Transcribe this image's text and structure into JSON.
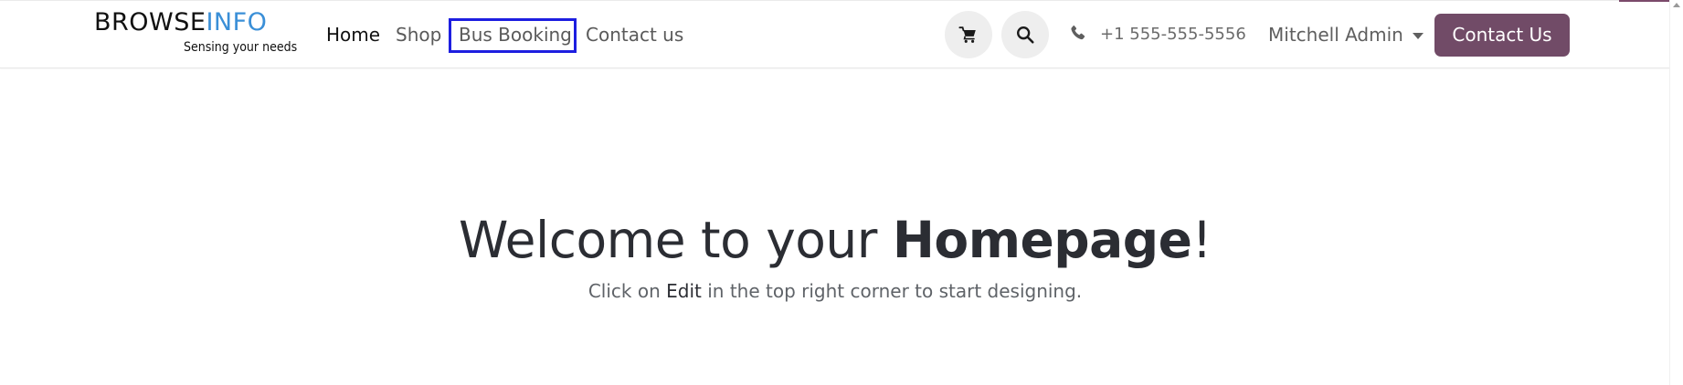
{
  "header": {
    "logo": {
      "part1": "BROWSE",
      "part2": "INFO",
      "tagline": "Sensing your needs"
    },
    "nav": {
      "home": "Home",
      "shop": "Shop",
      "bus_booking": "Bus Booking",
      "contact": "Contact us"
    },
    "actions": {
      "cart_icon": "cart-icon",
      "search_icon": "search-icon"
    },
    "phone": "+1 555-555-5556",
    "user": {
      "name": "Mitchell Admin"
    },
    "cta_label": "Contact Us"
  },
  "hero": {
    "title_prefix": "Welcome to your ",
    "title_emphasis": "Homepage",
    "title_suffix": "!",
    "subtitle_prefix": "Click on ",
    "subtitle_emphasis": "Edit",
    "subtitle_suffix": " in the top right corner to start designing."
  },
  "colors": {
    "brand_primary": "#714b67",
    "highlight_border": "#1d1ee0",
    "logo_accent": "#3a8fd7",
    "top_accent": "#7b4a6b"
  }
}
